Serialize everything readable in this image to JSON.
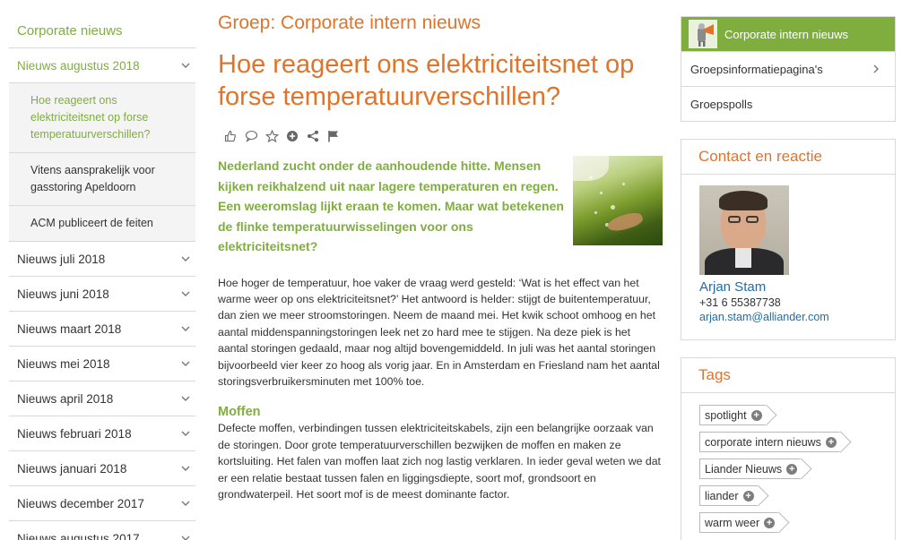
{
  "sidebar": {
    "heading": "Corporate nieuws",
    "open_month": "Nieuws augustus 2018",
    "sub_items": [
      {
        "label": "Hoe reageert ons elektriciteitsnet op forse temperatuurverschillen?"
      },
      {
        "label": "Vitens aansprakelijk voor gasstoring Apeldoorn"
      },
      {
        "label": "ACM publiceert de feiten"
      }
    ],
    "months": [
      {
        "label": "Nieuws juli 2018"
      },
      {
        "label": "Nieuws juni 2018"
      },
      {
        "label": "Nieuws maart 2018"
      },
      {
        "label": "Nieuws mei 2018"
      },
      {
        "label": "Nieuws april 2018"
      },
      {
        "label": "Nieuws februari 2018"
      },
      {
        "label": "Nieuws januari 2018"
      },
      {
        "label": "Nieuws december 2017"
      },
      {
        "label": "Nieuws augustus 2017"
      }
    ]
  },
  "article": {
    "group_title": "Groep: Corporate intern nieuws",
    "title": "Hoe reageert ons elektriciteitsnet op forse temperatuurverschillen?",
    "action_icons": [
      "like-icon",
      "comment-icon",
      "favorite-icon",
      "add-icon",
      "share-icon",
      "flag-icon"
    ],
    "lead": "Nederland zucht onder de aanhoudende hitte. Mensen kijken reikhalzend uit naar lagere temperaturen en regen. Een weeromslag lijkt eraan te komen. Maar wat betekenen de flinke temperatuurwisselingen voor ons elektriciteitsnet?",
    "paragraph1": "Hoe hoger de temperatuur, hoe vaker de vraag werd gesteld: ‘Wat is het effect van het warme weer op ons elektriciteitsnet?’ Het antwoord is helder: stijgt de buitentemperatuur, dan zien we meer stroomstoringen. Neem de maand mei. Het kwik schoot omhoog en het aantal middenspanningstoringen leek net zo hard mee te stijgen. Na deze piek is het aantal storingen gedaald, maar nog altijd bovengemiddeld. In juli was het aantal storingen bijvoorbeeld vier keer zo hoog als vorig jaar. En in Amsterdam en Friesland nam het aantal storingsverbruikersminuten met 100% toe.",
    "subheading": "Moffen",
    "paragraph2": "Defecte moffen, verbindingen tussen elektriciteitskabels, zijn een belangrijke oorzaak van de storingen. Door grote temperatuurverschillen bezwijken de moffen en maken ze kortsluiting. Het falen van moffen laat zich nog lastig verklaren. In ieder geval weten we dat er een relatie bestaat tussen falen en liggingsdiepte, soort mof, grondsoort en grondwaterpeil. Het soort mof is de meest dominante factor."
  },
  "right": {
    "group_name": "Corporate intern nieuws",
    "group_links": [
      {
        "label": "Groepsinformatiepagina's"
      },
      {
        "label": "Groepspolls"
      }
    ],
    "contact_title": "Contact en reactie",
    "contact_name": "Arjan Stam",
    "contact_phone": "+31 6 55387738",
    "contact_email": "arjan.stam@alliander.com",
    "tags_title": "Tags",
    "tags": [
      {
        "label": "spotlight"
      },
      {
        "label": "corporate intern nieuws"
      },
      {
        "label": "Liander Nieuws"
      },
      {
        "label": "liander"
      },
      {
        "label": "warm weer"
      }
    ]
  },
  "colors": {
    "accent_green": "#7fae3f",
    "accent_orange": "#e0742b",
    "link_blue": "#1f6da8"
  }
}
